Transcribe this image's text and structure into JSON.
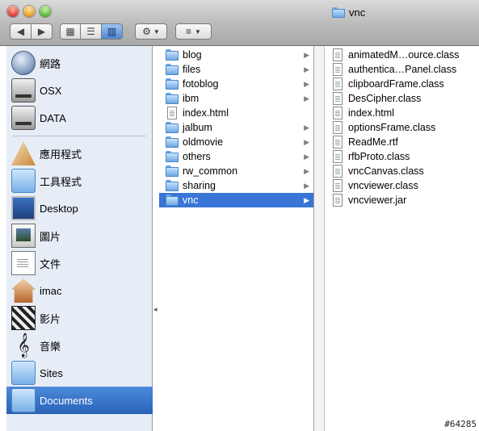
{
  "window": {
    "title": "vnc"
  },
  "toolbar": {
    "back_icon": "back-arrow-icon",
    "forward_icon": "forward-arrow-icon",
    "view_modes": [
      "icon-view-icon",
      "list-view-icon",
      "column-view-icon"
    ],
    "active_view": "column",
    "action_icon": "gear-icon",
    "arrange_icon": "arrange-icon"
  },
  "sidebar": {
    "items": [
      {
        "label": "網路",
        "icon": "network-globe-icon"
      },
      {
        "label": "OSX",
        "icon": "hard-disk-icon"
      },
      {
        "label": "DATA",
        "icon": "hard-disk-icon"
      },
      {
        "label": "應用程式",
        "icon": "applications-icon"
      },
      {
        "label": "工具程式",
        "icon": "utilities-folder-icon"
      },
      {
        "label": "Desktop",
        "icon": "desktop-icon"
      },
      {
        "label": "圖片",
        "icon": "pictures-icon"
      },
      {
        "label": "文件",
        "icon": "document-icon"
      },
      {
        "label": "imac",
        "icon": "home-icon"
      },
      {
        "label": "影片",
        "icon": "movies-icon"
      },
      {
        "label": "音樂",
        "icon": "music-icon"
      },
      {
        "label": "Sites",
        "icon": "sites-folder-icon"
      },
      {
        "label": "Documents",
        "icon": "documents-folder-icon",
        "selected": true
      }
    ]
  },
  "column1": {
    "items": [
      {
        "label": "blog",
        "kind": "folder"
      },
      {
        "label": "files",
        "kind": "folder"
      },
      {
        "label": "fotoblog",
        "kind": "folder"
      },
      {
        "label": "ibm",
        "kind": "folder"
      },
      {
        "label": "index.html",
        "kind": "file"
      },
      {
        "label": "jalbum",
        "kind": "folder"
      },
      {
        "label": "oldmovie",
        "kind": "folder"
      },
      {
        "label": "others",
        "kind": "folder"
      },
      {
        "label": "rw_common",
        "kind": "folder"
      },
      {
        "label": "sharing",
        "kind": "folder"
      },
      {
        "label": "vnc",
        "kind": "folder",
        "selected": true
      }
    ]
  },
  "column2": {
    "items": [
      {
        "label": "animatedM…ource.class"
      },
      {
        "label": "authentica…Panel.class"
      },
      {
        "label": "clipboardFrame.class"
      },
      {
        "label": "DesCipher.class"
      },
      {
        "label": "index.html"
      },
      {
        "label": "optionsFrame.class"
      },
      {
        "label": "ReadMe.rtf"
      },
      {
        "label": "rfbProto.class"
      },
      {
        "label": "vncCanvas.class"
      },
      {
        "label": "vncviewer.class"
      },
      {
        "label": "vncviewer.jar"
      }
    ]
  },
  "watermark": "#64285",
  "colors": {
    "selection": "#3875d7",
    "sidebar_bg": "#e7edf6",
    "sidebar_selected": "#2863b8"
  }
}
